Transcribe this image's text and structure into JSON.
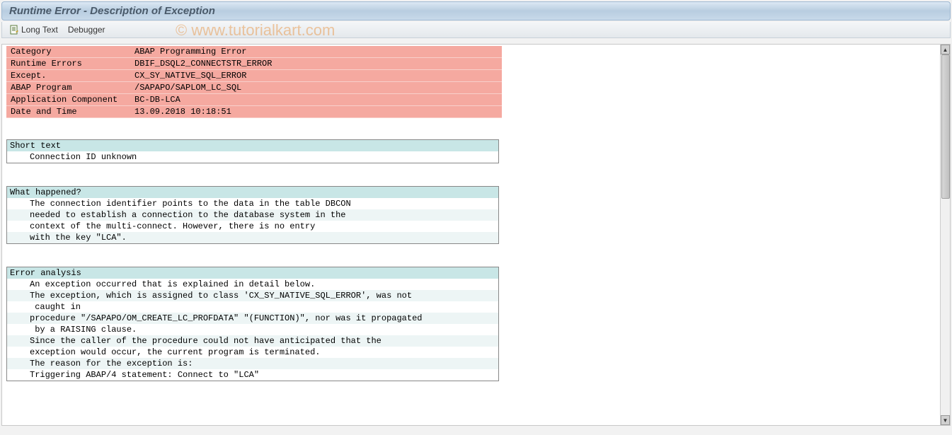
{
  "titlebar": {
    "title": "Runtime Error - Description of Exception"
  },
  "toolbar": {
    "long_text": "Long Text",
    "debugger": "Debugger"
  },
  "watermark": "© www.tutorialkart.com",
  "info": {
    "rows": [
      {
        "label": "Category",
        "value": "ABAP Programming Error"
      },
      {
        "label": "Runtime Errors",
        "value": "DBIF_DSQL2_CONNECTSTR_ERROR"
      },
      {
        "label": "Except.",
        "value": "CX_SY_NATIVE_SQL_ERROR"
      },
      {
        "label": "ABAP Program",
        "value": "/SAPAPO/SAPLOM_LC_SQL"
      },
      {
        "label": "Application Component",
        "value": "BC-DB-LCA"
      },
      {
        "label": "Date and Time",
        "value": "13.09.2018 10:18:51"
      }
    ]
  },
  "sections": {
    "short_text": {
      "header": "Short text",
      "lines": [
        "Connection ID unknown"
      ]
    },
    "what_happened": {
      "header": "What happened?",
      "lines": [
        "The connection identifier points to the data in the table DBCON",
        "needed to establish a connection to the database system in the",
        "context of the multi-connect. However, there is no entry",
        "with the key \"LCA\"."
      ]
    },
    "error_analysis": {
      "header": "Error analysis",
      "lines": [
        "An exception occurred that is explained in detail below.",
        "The exception, which is assigned to class 'CX_SY_NATIVE_SQL_ERROR', was not",
        " caught in",
        "procedure \"/SAPAPO/OM_CREATE_LC_PROFDATA\" \"(FUNCTION)\", nor was it propagated",
        " by a RAISING clause.",
        "Since the caller of the procedure could not have anticipated that the",
        "exception would occur, the current program is terminated.",
        "The reason for the exception is:",
        "Triggering ABAP/4 statement: Connect to \"LCA\""
      ]
    }
  }
}
